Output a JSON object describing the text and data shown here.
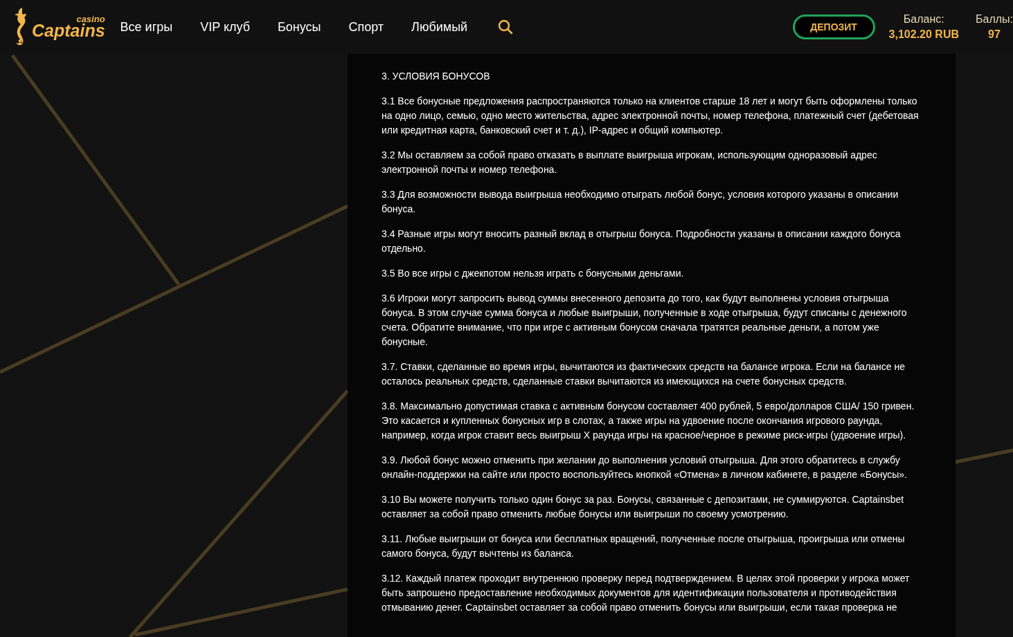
{
  "header": {
    "logo": {
      "small": "casino",
      "main": "Captains"
    },
    "nav": [
      {
        "label": "Все игры"
      },
      {
        "label": "VIP клуб"
      },
      {
        "label": "Бонусы"
      },
      {
        "label": "Спорт"
      },
      {
        "label": "Любимый"
      }
    ],
    "deposit_button": "ДЕПОЗИТ",
    "stats": [
      {
        "label": "Баланс:",
        "value": "3,102.20 RUB"
      },
      {
        "label": "Баллы:",
        "value": "97"
      }
    ]
  },
  "content": {
    "heading": "3. УСЛОВИЯ БОНУСОВ",
    "paragraphs": [
      "3.1 Все бонусные предложения распространяются только на клиентов старше 18 лет и могут быть оформлены только на одно лицо, семью, одно место жительства, адрес электронной почты, номер телефона, платежный счет (дебетовая или кредитная карта, банковский счет и т. д.), IP-адрес и общий компьютер.",
      "3.2 Мы оставляем за собой право отказать в выплате выигрыша игрокам, использующим одноразовый адрес электронной почты и номер телефона.",
      "3.3 Для возможности вывода выигрыша необходимо отыграть любой бонус, условия которого указаны в описании бонуса.",
      "3.4 Разные игры могут вносить разный вклад в отыгрыш бонуса. Подробности указаны в описании каждого бонуса отдельно.",
      "3.5 Во все игры с джекпотом нельзя играть с бонусными деньгами.",
      "3.6 Игроки могут запросить вывод суммы внесенного депозита до того, как будут выполнены условия отыгрыша бонуса. В этом случае сумма бонуса и любые выигрыши, полученные в ходе отыгрыша, будут списаны с денежного счета. Обратите внимание, что при игре с активным бонусом сначала тратятся реальные деньги, а потом уже бонусные.",
      "3.7. Ставки, сделанные во время игры, вычитаются из фактических средств на балансе игрока. Если на балансе не осталось реальных средств, сделанные ставки вычитаются из имеющихся на счете бонусных средств.",
      "3.8. Максимально допустимая ставка с активным бонусом составляет 400 рублей, 5 евро/долларов США/ 150 гривен. Это касается и купленных бонусных игр в слотах, а также игры на удвоение после окончания игрового раунда, например, когда игрок ставит весь выигрыш X раунда игры на красное/черное в режиме риск-игры (удвоение игры).",
      "3.9. Любой бонус можно отменить при желании до выполнения условий отыгрыша. Для этого обратитесь в службу онлайн-поддержки на сайте или просто воспользуйтесь кнопкой «Отмена» в личном кабинете, в разделе «Бонусы».",
      "3.10 Вы можете получить только один бонус за раз. Бонусы, связанные с депозитами, не суммируются. Captainsbet оставляет за собой право отменить любые бонусы или выигрыши по своему усмотрению.",
      "3.11. Любые выигрыши от бонуса или бесплатных вращений, полученные после отыгрыша, проигрыша или отмены самого бонуса, будут вычтены из баланса.",
      "3.12. Каждый платеж проходит внутреннюю проверку перед подтверждением. В целях этой проверки у игрока может быть запрошено предоставление необходимых документов для идентификации пользователя и противодействия отмыванию денег. Captainsbet оставляет за собой право отменить бонусы или выигрыши, если такая проверка не"
    ]
  }
}
